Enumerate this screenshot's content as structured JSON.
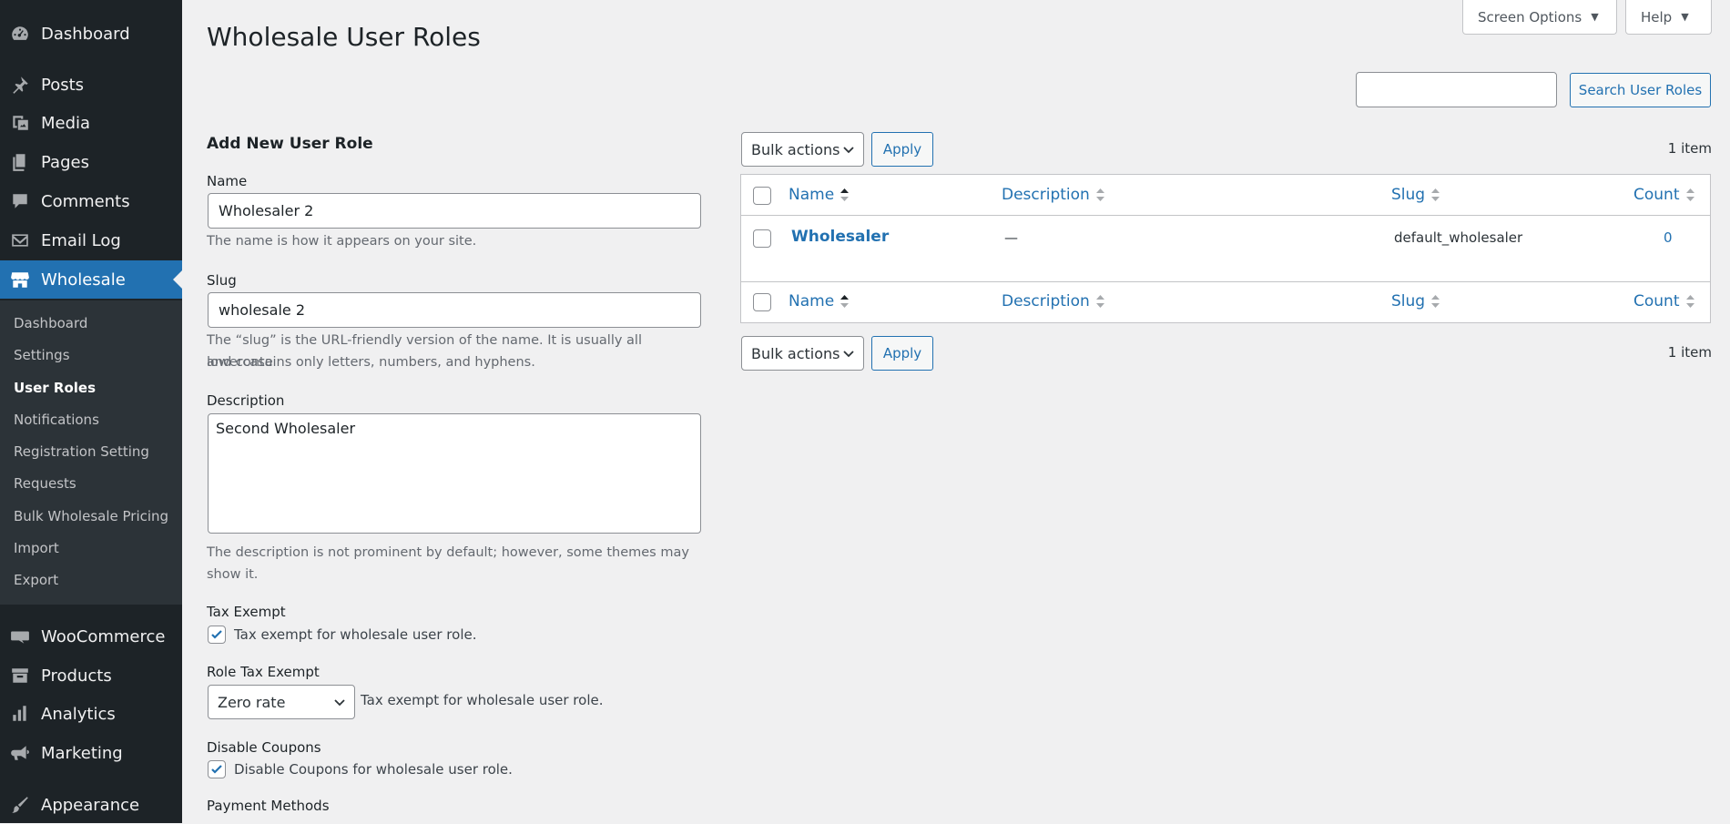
{
  "sidebar": {
    "items": [
      {
        "label": "Dashboard",
        "icon": "dashboard-icon"
      },
      {
        "label": "Posts",
        "icon": "pin-icon"
      },
      {
        "label": "Media",
        "icon": "media-icon"
      },
      {
        "label": "Pages",
        "icon": "pages-icon"
      },
      {
        "label": "Comments",
        "icon": "comment-icon"
      },
      {
        "label": "Email Log",
        "icon": "email-icon"
      },
      {
        "label": "Wholesale",
        "icon": "store-icon"
      },
      {
        "label": "WooCommerce",
        "icon": "woo-icon"
      },
      {
        "label": "Products",
        "icon": "archive-icon"
      },
      {
        "label": "Analytics",
        "icon": "chart-icon"
      },
      {
        "label": "Marketing",
        "icon": "megaphone-icon"
      },
      {
        "label": "Appearance",
        "icon": "brush-icon"
      }
    ],
    "submenu": [
      "Dashboard",
      "Settings",
      "User Roles",
      "Notifications",
      "Registration Setting",
      "Requests",
      "Bulk Wholesale Pricing",
      "Import",
      "Export"
    ]
  },
  "top": {
    "screen_options": "Screen Options",
    "help": "Help"
  },
  "page_title": "Wholesale User Roles",
  "search": {
    "value": "",
    "button": "Search User Roles"
  },
  "form": {
    "title": "Add New User Role",
    "name_label": "Name",
    "name_value": "Wholesaler 2",
    "name_desc": "The name is how it appears on your site.",
    "slug_label": "Slug",
    "slug_value": "wholesale 2",
    "slug_desc_1": "The “slug” is the URL-friendly version of the name. It is usually all lowercase",
    "slug_desc_2": "and contains only letters, numbers, and hyphens.",
    "description_label": "Description",
    "description_value": "Second Wholesaler",
    "description_desc_1": "The description is not prominent by default; however, some themes may",
    "description_desc_2": "show it.",
    "tax_exempt_label": "Tax Exempt",
    "tax_exempt_checkbox": "Tax exempt for wholesale user role.",
    "tax_exempt_checked": true,
    "role_tax_label": "Role Tax Exempt",
    "role_tax_select": "Zero rate",
    "role_tax_desc": "Tax exempt for wholesale user role.",
    "disable_coupons_label": "Disable Coupons",
    "disable_coupons_checkbox": "Disable Coupons for wholesale user role.",
    "disable_coupons_checked": true,
    "payment_methods_label": "Payment Methods"
  },
  "table": {
    "bulk_actions": "Bulk actions",
    "apply": "Apply",
    "item_count": "1 item",
    "columns": [
      "Name",
      "Description",
      "Slug",
      "Count"
    ],
    "rows": [
      {
        "name": "Wholesaler",
        "description": "—",
        "slug": "default_wholesaler",
        "count": "0"
      }
    ]
  },
  "colors": {
    "sidebar_bg": "#1d2327",
    "accent": "#2271b1",
    "page_bg": "#f0f0f1"
  }
}
